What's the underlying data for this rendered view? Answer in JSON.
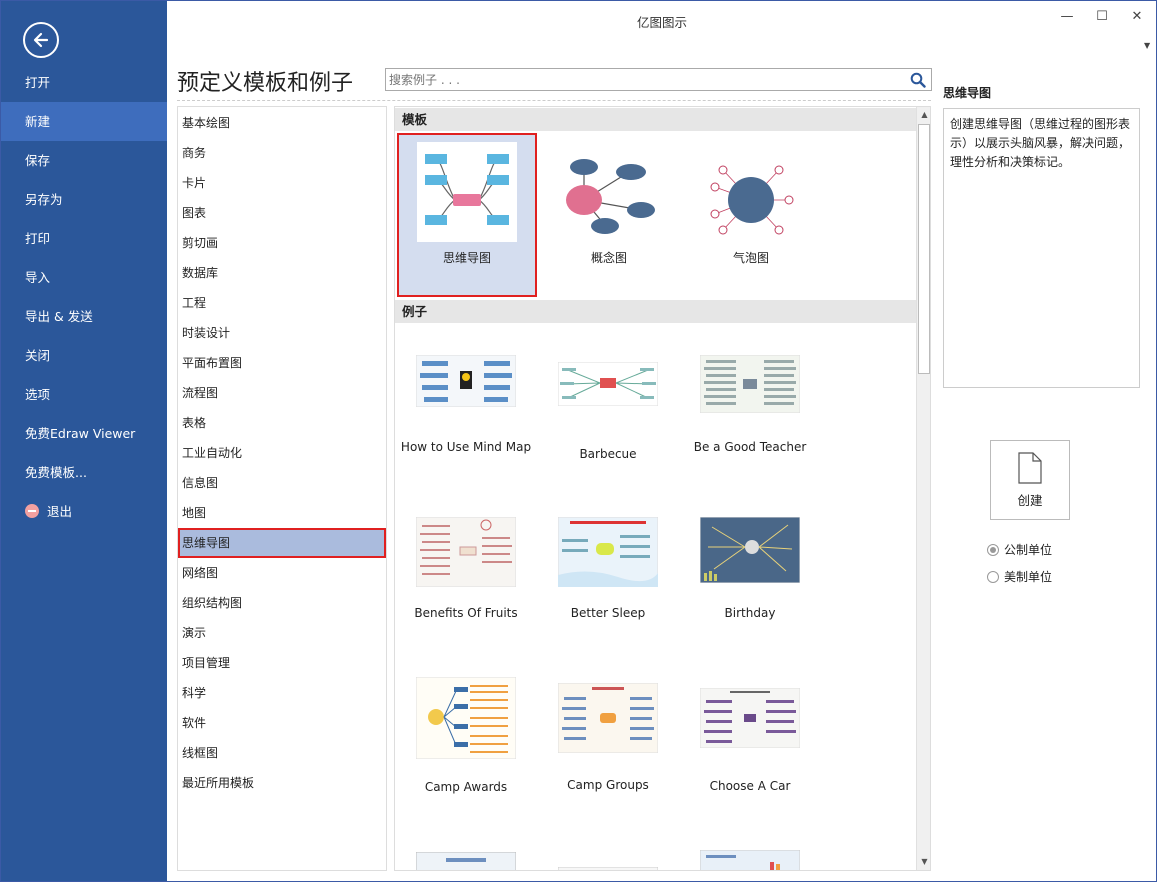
{
  "window": {
    "title": "亿图图示",
    "min_glyph": "—",
    "max_glyph": "☐",
    "close_glyph": "✕",
    "dropdown_glyph": "▼"
  },
  "sidebar": {
    "back_icon": "back-arrow-icon",
    "items": [
      {
        "label": "打开"
      },
      {
        "label": "新建"
      },
      {
        "label": "保存"
      },
      {
        "label": "另存为"
      },
      {
        "label": "打印"
      },
      {
        "label": "导入"
      },
      {
        "label": "导出 & 发送"
      },
      {
        "label": "关闭"
      },
      {
        "label": "选项"
      },
      {
        "label": "免费Edraw Viewer"
      },
      {
        "label": "免费模板..."
      },
      {
        "label": "退出"
      }
    ],
    "active_index": 1,
    "colors": {
      "background": "#2b579a",
      "active": "#3e6dbd"
    }
  },
  "header": {
    "title": "预定义模板和例子",
    "search_placeholder": "搜索例子 . . ."
  },
  "categories": {
    "items": [
      "基本绘图",
      "商务",
      "卡片",
      "图表",
      "剪切画",
      "数据库",
      "工程",
      "时装设计",
      "平面布置图",
      "流程图",
      "表格",
      "工业自动化",
      "信息图",
      "地图",
      "思维导图",
      "网络图",
      "组织结构图",
      "演示",
      "项目管理",
      "科学",
      "软件",
      "线框图",
      "最近所用模板"
    ],
    "selected_index": 14
  },
  "gallery": {
    "templates_header": "模板",
    "examples_header": "例子",
    "templates": [
      {
        "label": "思维导图",
        "icon": "mind-map-icon"
      },
      {
        "label": "概念图",
        "icon": "concept-map-icon"
      },
      {
        "label": "气泡图",
        "icon": "bubble-diagram-icon"
      }
    ],
    "examples": [
      {
        "label": "How to Use Mind Map"
      },
      {
        "label": "Barbecue"
      },
      {
        "label": "Be a Good Teacher"
      },
      {
        "label": "Benefits Of Fruits"
      },
      {
        "label": "Better Sleep"
      },
      {
        "label": "Birthday"
      },
      {
        "label": "Camp Awards"
      },
      {
        "label": "Camp Groups"
      },
      {
        "label": "Choose A Car"
      }
    ],
    "scroll_up_glyph": "▲",
    "scroll_down_glyph": "▼"
  },
  "details": {
    "title": "思维导图",
    "description": "创建思维导图（思维过程的图形表示）以展示头脑风暴，解决问题，理性分析和决策标记。",
    "create_label": "创建",
    "units": [
      {
        "label": "公制单位",
        "checked": true
      },
      {
        "label": "美制单位",
        "checked": false
      }
    ]
  }
}
